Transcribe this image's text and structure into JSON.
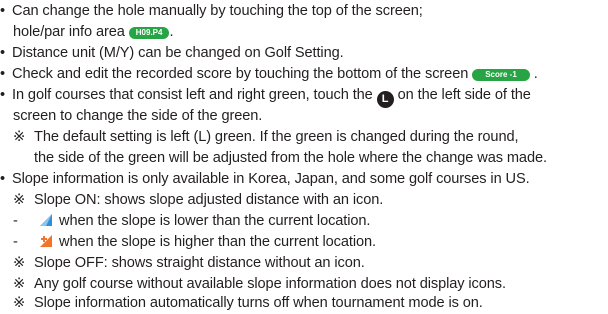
{
  "bullets": {
    "b1_l1": "Can change the hole manually by touching the top of the screen;",
    "b1_l2_pre": "hole/par info area",
    "b1_pill": "H09.P4",
    "b1_l2_post": ".",
    "b2": "Distance unit (M/Y) can be changed on Golf Setting.",
    "b3_pre": "Check and edit the recorded score by touching the bottom of the screen",
    "b3_pill": "Score -1",
    "b3_post": ".",
    "b4_pre": "In golf courses that consist left and right green, touch the",
    "b4_icon": "L",
    "b4_post": "on the left side  of the",
    "b4_l2": "screen to change the side of the green.",
    "b4_note_l1": "The default setting is left (L) green. If the green is changed during the round,",
    "b4_note_l2": "the side of the green will be adjusted from the hole where the change was made.",
    "b5": "Slope information is only available in Korea, Japan, and some golf courses in US.",
    "slope_on": "Slope ON: shows slope adjusted distance with an icon.",
    "slope_lower": "when the slope is lower than the current location.",
    "slope_higher": "when the slope is higher than the current location.",
    "slope_off": "Slope OFF: shows straight distance without an icon.",
    "no_slope": "Any golf course without available slope information does not display icons.",
    "auto_off": "Slope information automatically turns off when tournament mode is on."
  },
  "symbols": {
    "bullet": "•",
    "note": "※",
    "dash": "-"
  },
  "colors": {
    "pill_green": "#27a545",
    "slope_blue": "#2f8fd8",
    "slope_orange": "#f2742a",
    "text": "#231f20"
  },
  "icons": [
    "lr-green-icon",
    "slope-down-icon",
    "slope-up-icon"
  ]
}
